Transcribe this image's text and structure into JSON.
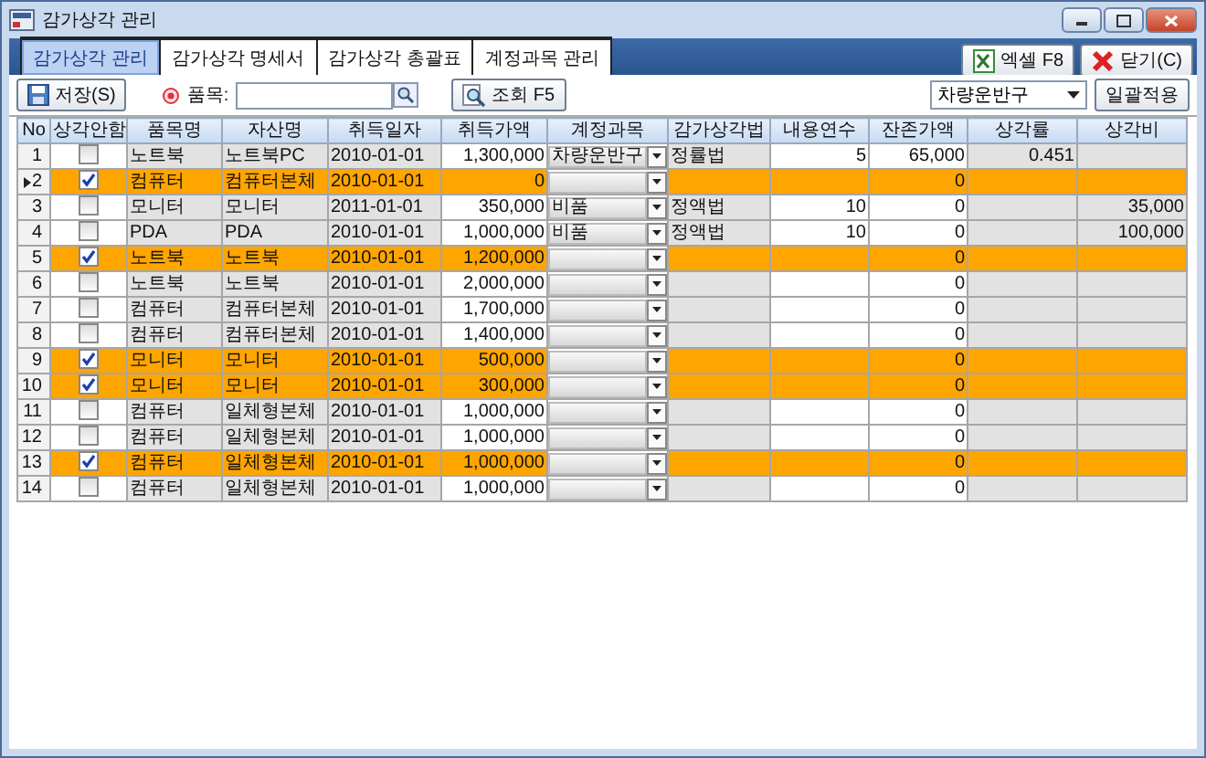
{
  "window": {
    "title": "감가상각 관리"
  },
  "tabs": [
    {
      "label": "감가상각 관리",
      "selected": true
    },
    {
      "label": "감가상각 명세서",
      "selected": false
    },
    {
      "label": "감가상각 총괄표",
      "selected": false
    },
    {
      "label": "계정과목 관리",
      "selected": false
    }
  ],
  "top_buttons": [
    {
      "label": "엑셀 F8",
      "kind": "excel"
    },
    {
      "label": "닫기(C)",
      "kind": "close"
    }
  ],
  "toolbar": {
    "save": "저장(S)",
    "item_label": "품목:",
    "search": "조회 F5",
    "account_select": "차량운반구",
    "apply": "일괄적용"
  },
  "table": {
    "columns": [
      "No",
      "상각안함",
      "품목명",
      "자산명",
      "취득일자",
      "취득가액",
      "계정과목",
      "감가상각법",
      "내용연수",
      "잔존가액",
      "상각률",
      "상각비"
    ],
    "rows": [
      {
        "no": "1",
        "checked": false,
        "selected": false,
        "item": "노트북",
        "asset": "노트북PC",
        "date": "2010-01-01",
        "cost": "1,300,000",
        "account": "차량운반구",
        "method": "정률법",
        "life": "5",
        "residual": "65,000",
        "rate": "0.451"
      },
      {
        "no": "2",
        "checked": true,
        "selected": true,
        "item": "컴퓨터",
        "asset": "컴퓨터본체",
        "date": "2010-01-01",
        "cost": "0",
        "residual": "0"
      },
      {
        "no": "3",
        "checked": false,
        "selected": false,
        "item": "모니터",
        "asset": "모니터",
        "date": "2011-01-01",
        "cost": "350,000",
        "account": "비품",
        "method": "정액법",
        "life": "10",
        "residual": "0",
        "expense": "35,000"
      },
      {
        "no": "4",
        "checked": false,
        "selected": false,
        "item": "PDA",
        "asset": "PDA",
        "date": "2010-01-01",
        "cost": "1,000,000",
        "account": "비품",
        "method": "정액법",
        "life": "10",
        "residual": "0",
        "expense": "100,000"
      },
      {
        "no": "5",
        "checked": true,
        "selected": false,
        "item": "노트북",
        "asset": "노트북",
        "date": "2010-01-01",
        "cost": "1,200,000",
        "residual": "0"
      },
      {
        "no": "6",
        "checked": false,
        "selected": false,
        "item": "노트북",
        "asset": "노트북",
        "date": "2010-01-01",
        "cost": "2,000,000",
        "residual": "0"
      },
      {
        "no": "7",
        "checked": false,
        "selected": false,
        "item": "컴퓨터",
        "asset": "컴퓨터본체",
        "date": "2010-01-01",
        "cost": "1,700,000",
        "residual": "0"
      },
      {
        "no": "8",
        "checked": false,
        "selected": false,
        "item": "컴퓨터",
        "asset": "컴퓨터본체",
        "date": "2010-01-01",
        "cost": "1,400,000",
        "residual": "0"
      },
      {
        "no": "9",
        "checked": true,
        "selected": false,
        "item": "모니터",
        "asset": "모니터",
        "date": "2010-01-01",
        "cost": "500,000",
        "residual": "0"
      },
      {
        "no": "10",
        "checked": true,
        "selected": false,
        "item": "모니터",
        "asset": "모니터",
        "date": "2010-01-01",
        "cost": "300,000",
        "residual": "0"
      },
      {
        "no": "11",
        "checked": false,
        "selected": false,
        "item": "컴퓨터",
        "asset": "일체형본체",
        "date": "2010-01-01",
        "cost": "1,000,000",
        "residual": "0"
      },
      {
        "no": "12",
        "checked": false,
        "selected": false,
        "item": "컴퓨터",
        "asset": "일체형본체",
        "date": "2010-01-01",
        "cost": "1,000,000",
        "residual": "0"
      },
      {
        "no": "13",
        "checked": true,
        "selected": false,
        "item": "컴퓨터",
        "asset": "일체형본체",
        "date": "2010-01-01",
        "cost": "1,000,000",
        "residual": "0"
      },
      {
        "no": "14",
        "checked": false,
        "selected": false,
        "item": "컴퓨터",
        "asset": "일체형본체",
        "date": "2010-01-01",
        "cost": "1,000,000",
        "residual": "0"
      }
    ]
  }
}
